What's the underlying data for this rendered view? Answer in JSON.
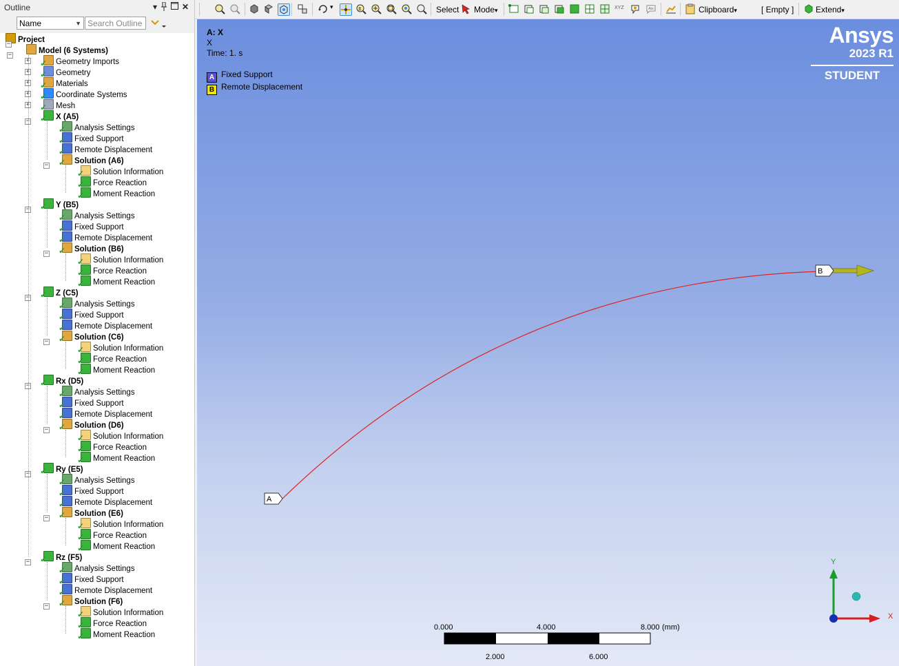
{
  "outline": {
    "title": "Outline",
    "pin_glyph": "📌",
    "close_glyph": "✕",
    "name_filter": "Name",
    "search_placeholder": "Search Outline",
    "tree": [
      {
        "label": "Project",
        "level": 0,
        "bold": true,
        "icon": "project-icon"
      },
      {
        "label": "Model (6 Systems)",
        "level": 1,
        "bold": true,
        "icon": "model-icon"
      },
      {
        "label": "Geometry Imports",
        "level": 2,
        "icon": "geometry-imports-icon"
      },
      {
        "label": "Geometry",
        "level": 2,
        "icon": "geometry-icon"
      },
      {
        "label": "Materials",
        "level": 2,
        "icon": "materials-icon"
      },
      {
        "label": "Coordinate Systems",
        "level": 2,
        "icon": "coordinate-systems-icon"
      },
      {
        "label": "Mesh",
        "level": 2,
        "icon": "mesh-icon"
      },
      {
        "label": "X (A5)",
        "level": 2,
        "bold": true,
        "icon": "static-structural-icon"
      },
      {
        "label": "Analysis Settings",
        "level": 3,
        "icon": "analysis-settings-icon"
      },
      {
        "label": "Fixed Support",
        "level": 3,
        "icon": "fixed-support-icon"
      },
      {
        "label": "Remote Displacement",
        "level": 3,
        "icon": "remote-displacement-icon"
      },
      {
        "label": "Solution (A6)",
        "level": 3,
        "bold": true,
        "icon": "solution-icon"
      },
      {
        "label": "Solution Information",
        "level": 4,
        "icon": "solution-information-icon"
      },
      {
        "label": "Force Reaction",
        "level": 4,
        "icon": "force-reaction-icon"
      },
      {
        "label": "Moment Reaction",
        "level": 4,
        "icon": "moment-reaction-icon"
      },
      {
        "label": "Y (B5)",
        "level": 2,
        "bold": true,
        "icon": "static-structural-icon"
      },
      {
        "label": "Analysis Settings",
        "level": 3,
        "icon": "analysis-settings-icon"
      },
      {
        "label": "Fixed Support",
        "level": 3,
        "icon": "fixed-support-icon"
      },
      {
        "label": "Remote Displacement",
        "level": 3,
        "icon": "remote-displacement-icon"
      },
      {
        "label": "Solution (B6)",
        "level": 3,
        "bold": true,
        "icon": "solution-icon"
      },
      {
        "label": "Solution Information",
        "level": 4,
        "icon": "solution-information-icon"
      },
      {
        "label": "Force Reaction",
        "level": 4,
        "icon": "force-reaction-icon"
      },
      {
        "label": "Moment Reaction",
        "level": 4,
        "icon": "moment-reaction-icon"
      },
      {
        "label": "Z (C5)",
        "level": 2,
        "bold": true,
        "icon": "static-structural-icon"
      },
      {
        "label": "Analysis Settings",
        "level": 3,
        "icon": "analysis-settings-icon"
      },
      {
        "label": "Fixed Support",
        "level": 3,
        "icon": "fixed-support-icon"
      },
      {
        "label": "Remote Displacement",
        "level": 3,
        "icon": "remote-displacement-icon"
      },
      {
        "label": "Solution (C6)",
        "level": 3,
        "bold": true,
        "icon": "solution-icon"
      },
      {
        "label": "Solution Information",
        "level": 4,
        "icon": "solution-information-icon"
      },
      {
        "label": "Force Reaction",
        "level": 4,
        "icon": "force-reaction-icon"
      },
      {
        "label": "Moment Reaction",
        "level": 4,
        "icon": "moment-reaction-icon"
      },
      {
        "label": "Rx (D5)",
        "level": 2,
        "bold": true,
        "icon": "static-structural-icon"
      },
      {
        "label": "Analysis Settings",
        "level": 3,
        "icon": "analysis-settings-icon"
      },
      {
        "label": "Fixed Support",
        "level": 3,
        "icon": "fixed-support-icon"
      },
      {
        "label": "Remote Displacement",
        "level": 3,
        "icon": "remote-displacement-icon"
      },
      {
        "label": "Solution (D6)",
        "level": 3,
        "bold": true,
        "icon": "solution-icon"
      },
      {
        "label": "Solution Information",
        "level": 4,
        "icon": "solution-information-icon"
      },
      {
        "label": "Force Reaction",
        "level": 4,
        "icon": "force-reaction-icon"
      },
      {
        "label": "Moment Reaction",
        "level": 4,
        "icon": "moment-reaction-icon"
      },
      {
        "label": "Ry (E5)",
        "level": 2,
        "bold": true,
        "icon": "static-structural-icon"
      },
      {
        "label": "Analysis Settings",
        "level": 3,
        "icon": "analysis-settings-icon"
      },
      {
        "label": "Fixed Support",
        "level": 3,
        "icon": "fixed-support-icon"
      },
      {
        "label": "Remote Displacement",
        "level": 3,
        "icon": "remote-displacement-icon"
      },
      {
        "label": "Solution (E6)",
        "level": 3,
        "bold": true,
        "icon": "solution-icon"
      },
      {
        "label": "Solution Information",
        "level": 4,
        "icon": "solution-information-icon"
      },
      {
        "label": "Force Reaction",
        "level": 4,
        "icon": "force-reaction-icon"
      },
      {
        "label": "Moment Reaction",
        "level": 4,
        "icon": "moment-reaction-icon"
      },
      {
        "label": "Rz (F5)",
        "level": 2,
        "bold": true,
        "icon": "static-structural-icon"
      },
      {
        "label": "Analysis Settings",
        "level": 3,
        "icon": "analysis-settings-icon"
      },
      {
        "label": "Fixed Support",
        "level": 3,
        "icon": "fixed-support-icon"
      },
      {
        "label": "Remote Displacement",
        "level": 3,
        "icon": "remote-displacement-icon"
      },
      {
        "label": "Solution (F6)",
        "level": 3,
        "bold": true,
        "icon": "solution-icon"
      },
      {
        "label": "Solution Information",
        "level": 4,
        "icon": "solution-information-icon"
      },
      {
        "label": "Force Reaction",
        "level": 4,
        "icon": "force-reaction-icon"
      },
      {
        "label": "Moment Reaction",
        "level": 4,
        "icon": "moment-reaction-icon"
      }
    ]
  },
  "toolbar": {
    "select_label": "Select",
    "mode_label": "Mode",
    "clipboard_label": "Clipboard",
    "empty_label": "[ Empty ]",
    "extend_label": "Extend"
  },
  "viewport": {
    "title": "A: X",
    "subtitle": "X",
    "time": "Time: 1. s",
    "legend": [
      {
        "key": "A",
        "label": "Fixed Support",
        "color": "#5b4fd6"
      },
      {
        "key": "B",
        "label": "Remote Displacement",
        "color": "#f2e600"
      }
    ],
    "brand": {
      "name": "Ansys",
      "version": "2023 R1",
      "edition": "STUDENT"
    },
    "marker_a": "A",
    "marker_b": "B",
    "triad": {
      "x": "X",
      "y": "Y"
    },
    "scale": {
      "ticks_top": [
        "0.000",
        "4.000",
        "8.000"
      ],
      "unit": "(mm)",
      "ticks_bottom": [
        "2.000",
        "6.000"
      ]
    },
    "colors": {
      "curve": "#e0201c",
      "arrow": "#b5b520",
      "accent": "#2e8bff"
    }
  }
}
